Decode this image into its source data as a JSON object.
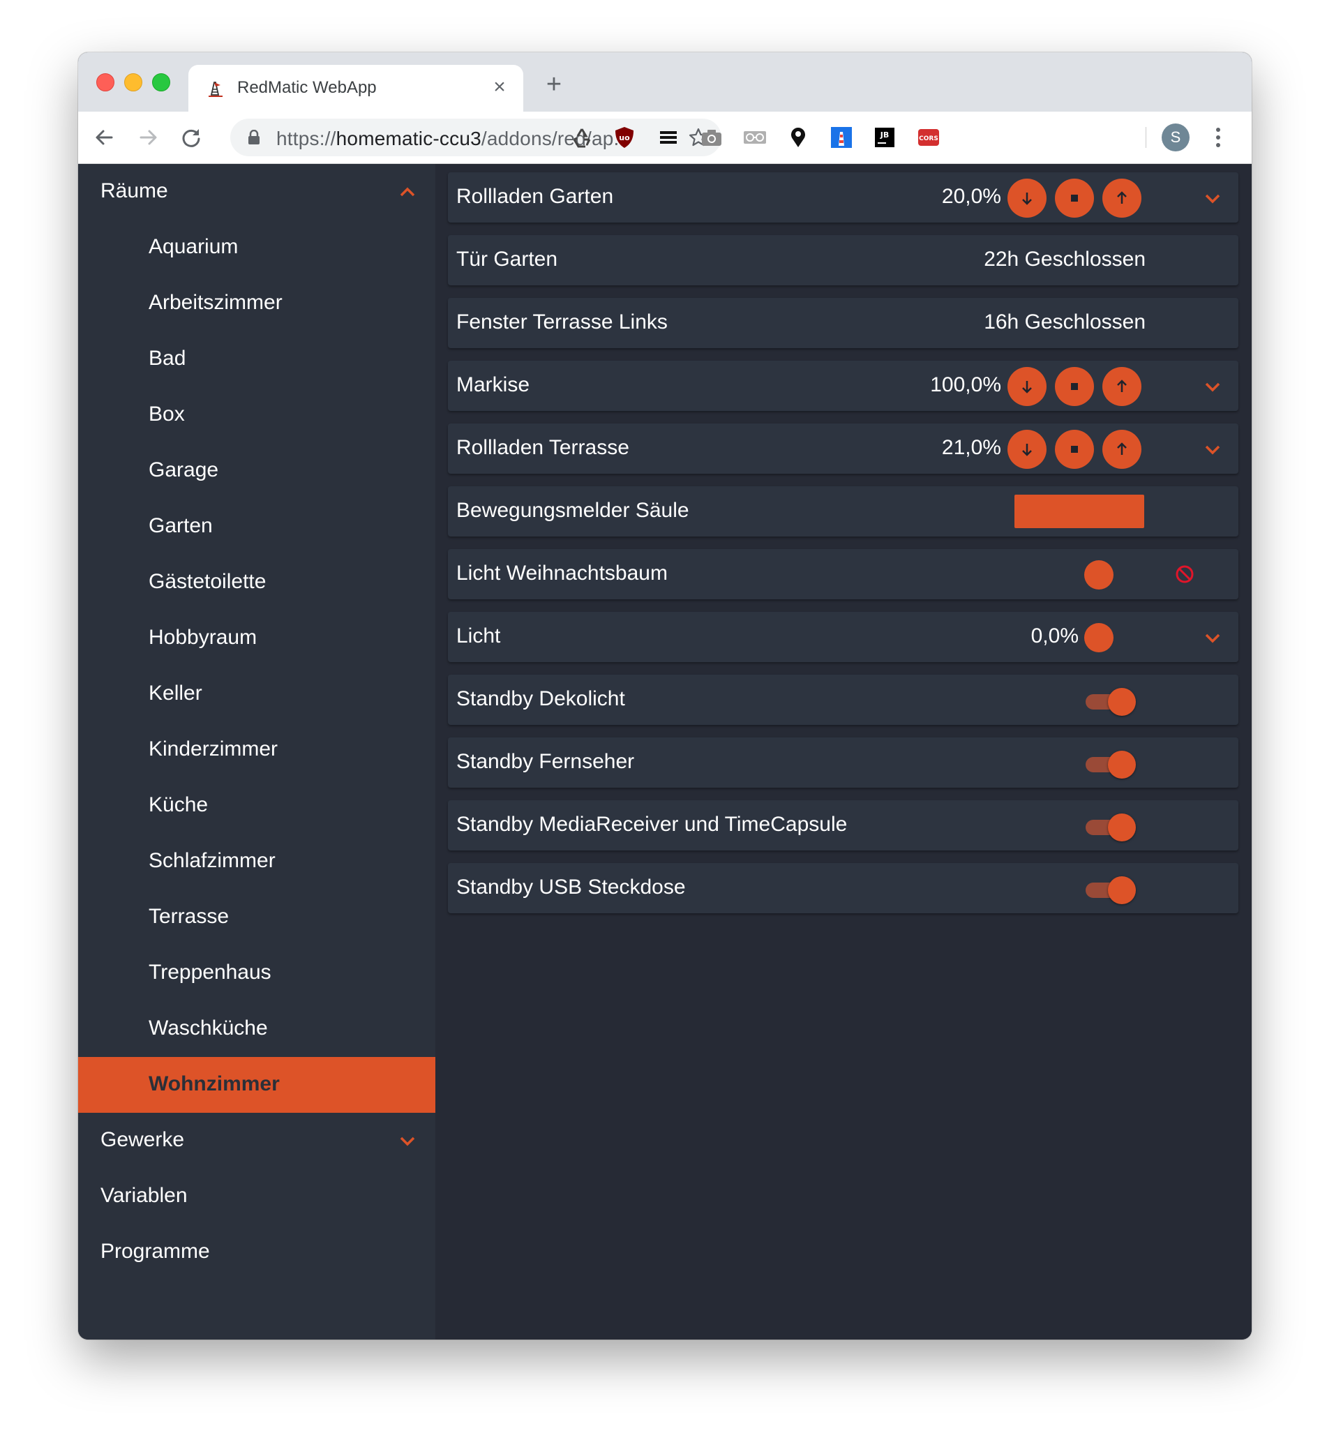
{
  "browser": {
    "tab_title": "RedMatic WebApp",
    "tab_close": "×",
    "new_tab": "+",
    "url_scheme": "https://",
    "url_host": "homematic-ccu3",
    "url_path": "/addons/red/ap...",
    "profile_initial": "S",
    "extensions": [
      "recycle-icon",
      "ublock-icon",
      "list-icon",
      "camera-icon",
      "glasses-icon",
      "location-pin-icon",
      "lighthouse-icon",
      "jb-icon",
      "cors-icon"
    ]
  },
  "sidebar": {
    "sections": [
      {
        "label": "Räume",
        "expanded": true
      },
      {
        "label": "Gewerke",
        "expanded": false
      },
      {
        "label": "Variablen"
      },
      {
        "label": "Programme"
      }
    ],
    "rooms": [
      "Aquarium",
      "Arbeitszimmer",
      "Bad",
      "Box",
      "Garage",
      "Garten",
      "Gästetoilette",
      "Hobbyraum",
      "Keller",
      "Kinderzimmer",
      "Küche",
      "Schlafzimmer",
      "Terrasse",
      "Treppenhaus",
      "Waschküche",
      "Wohnzimmer"
    ],
    "active_room": "Wohnzimmer"
  },
  "devices": [
    {
      "name": "Rollladen Garten",
      "value": "20,0%",
      "type": "blind"
    },
    {
      "name": "Tür Garten",
      "value": "22h Geschlossen",
      "type": "contact"
    },
    {
      "name": "Fenster Terrasse Links",
      "value": "16h Geschlossen",
      "type": "contact"
    },
    {
      "name": "Markise",
      "value": "100,0%",
      "type": "blind"
    },
    {
      "name": "Rollladen Terrasse",
      "value": "21,0%",
      "type": "blind"
    },
    {
      "name": "Bewegungsmelder Säule",
      "type": "motion"
    },
    {
      "name": "Licht Weihnachtsbaum",
      "type": "light-unreach"
    },
    {
      "name": "Licht",
      "value": "0,0%",
      "type": "dimmer"
    },
    {
      "name": "Standby Dekolicht",
      "type": "switch",
      "on": true
    },
    {
      "name": "Standby Fernseher",
      "type": "switch",
      "on": true
    },
    {
      "name": "Standby MediaReceiver und TimeCapsule",
      "type": "switch",
      "on": true
    },
    {
      "name": "Standby USB Steckdose",
      "type": "switch",
      "on": true
    }
  ],
  "colors": {
    "accent": "#dd5328",
    "sidebar_bg": "#2b313c",
    "content_bg": "#262a35",
    "row_bg": "#2d3440"
  }
}
